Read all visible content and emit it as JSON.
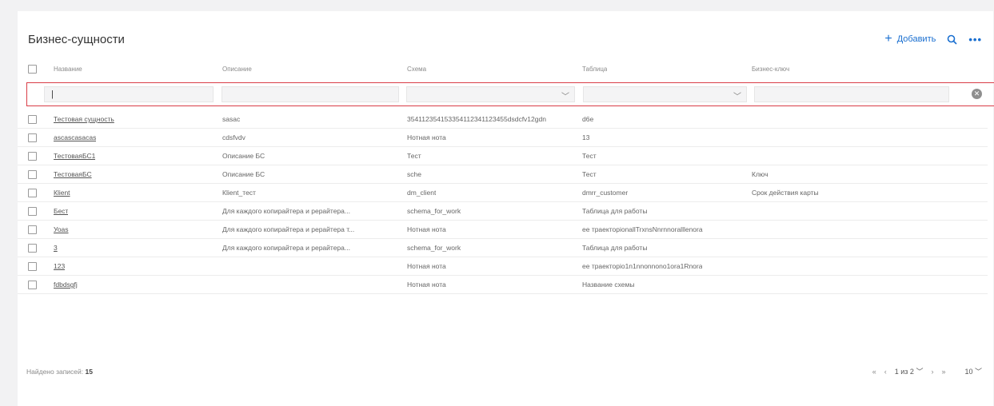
{
  "page": {
    "title": "Бизнес-сущности",
    "add_label": "Добавить",
    "search_icon": "search-icon",
    "more_icon": "more-icon"
  },
  "table": {
    "columns": [
      "Название",
      "Описание",
      "Схема",
      "Таблица",
      "Бизнес-ключ"
    ],
    "filter": {
      "name_value": "|",
      "description_value": "",
      "schema_value": "",
      "table_value": "",
      "key_value": ""
    },
    "rows": [
      {
        "name": "Тестовая сущность",
        "description": "sasac",
        "schema": "354112354153354112341123455dsdcfv12gdn",
        "table": "d6e",
        "key": ""
      },
      {
        "name": "ascascasacas",
        "description": "cdsfvdv",
        "schema": "Нотная нота",
        "table": "13",
        "key": ""
      },
      {
        "name": "ТестоваяБС1",
        "description": "Описание БС",
        "schema": "Тест",
        "table": "Тест",
        "key": ""
      },
      {
        "name": "ТестоваяБС",
        "description": "Описание БС",
        "schema": "sсhе",
        "table": "Тест",
        "key": "Ключ"
      },
      {
        "name": "Кlient",
        "description": "Кlient_тест",
        "schema": "dm_client",
        "table": "dmrr_customer",
        "key": "Срок действия карты"
      },
      {
        "name": "Бест",
        "description": "Для каждого копирайтера и рерайтера...",
        "schema": "schema_for_work",
        "table": "Таблица для работы",
        "key": ""
      },
      {
        "name": "Уоаs",
        "description": "Для каждого копирайтера и рерайтера т...",
        "schema": "Нотная нота",
        "table": "ee траекторіonallTrxnsNnrnnoralllenora",
        "key": ""
      },
      {
        "name": "3",
        "description": "Для каждого копирайтера и рерайтера...",
        "schema": "schema_for_work",
        "table": "Таблица для работы",
        "key": ""
      },
      {
        "name": "123",
        "description": "",
        "schema": "Нотная нота",
        "table": "ee траекторio1n1nnonnono1ora1Rnora",
        "key": ""
      },
      {
        "name": "fdbdsgfj",
        "description": "",
        "schema": "Нотная нота",
        "table": "Название схемы",
        "key": ""
      }
    ]
  },
  "footer": {
    "found_label": "Найдено записей:",
    "found_count": "15",
    "first_icon": "«",
    "prev_icon": "‹",
    "page_select": "1 из 2",
    "next_icon": "›",
    "last_icon": "»",
    "page_size": "10"
  },
  "colors": {
    "accent": "#1a6fd0",
    "filter_border": "#d93d47"
  }
}
